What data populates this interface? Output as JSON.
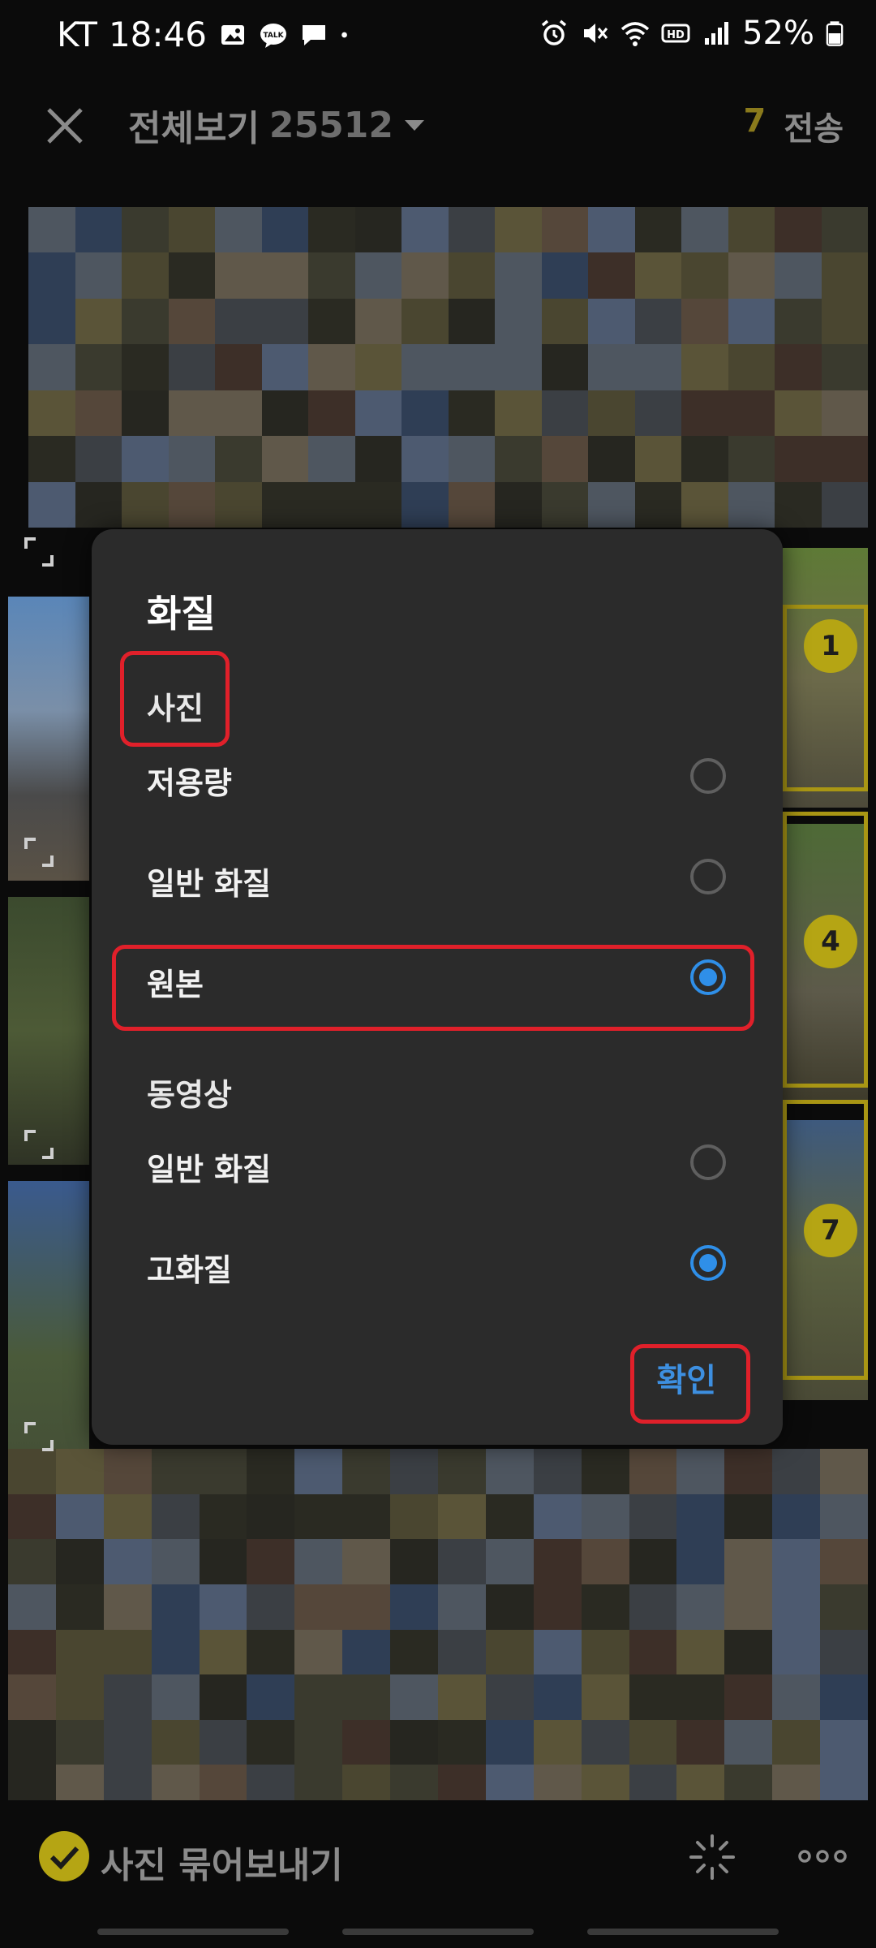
{
  "status_bar": {
    "carrier": "KT",
    "time": "18:46",
    "battery": "52%",
    "icons": [
      "gallery-icon",
      "kakaotalk-icon",
      "message-icon",
      "dot-icon",
      "alarm-icon",
      "mute-icon",
      "wifi-icon",
      "hd-icon",
      "signal-icon",
      "battery-icon"
    ]
  },
  "app_bar": {
    "title": "전체보기",
    "count": "25512",
    "selected_count": "7",
    "send_label": "전송"
  },
  "badges": [
    "1",
    "4",
    "7"
  ],
  "dialog": {
    "title": "화질",
    "photo_section": "사진",
    "photo_options": [
      {
        "label": "저용량",
        "selected": false
      },
      {
        "label": "일반 화질",
        "selected": false
      },
      {
        "label": "원본",
        "selected": true
      }
    ],
    "video_section": "동영상",
    "video_options": [
      {
        "label": "일반 화질",
        "selected": false
      },
      {
        "label": "고화질",
        "selected": true
      }
    ],
    "confirm_label": "확인",
    "accent_color": "#2f8fe8",
    "highlight_color": "#e0202a"
  },
  "bottom_bar": {
    "bundle_label": "사진 묶어보내기"
  }
}
